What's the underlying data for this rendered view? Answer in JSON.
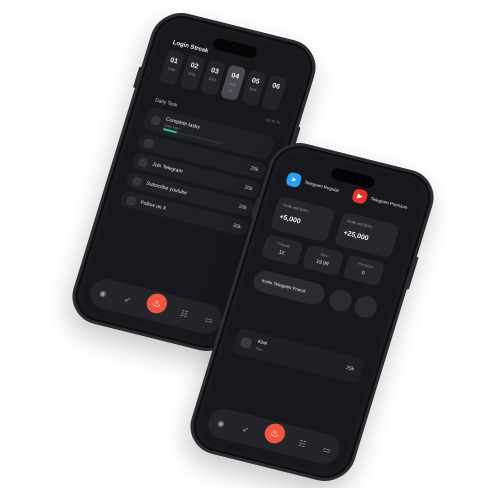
{
  "login_streak": {
    "title": "Login Streak",
    "days": [
      {
        "num": "01",
        "label": "100k",
        "check": ""
      },
      {
        "num": "02",
        "label": "200k",
        "check": ""
      },
      {
        "num": "03",
        "label": "300k",
        "check": ""
      },
      {
        "num": "04",
        "label": "400k",
        "check": "✓"
      },
      {
        "num": "05",
        "label": "500k",
        "check": ""
      },
      {
        "num": "06",
        "label": "",
        "check": ""
      }
    ],
    "more": "Up to 7k"
  },
  "daily": {
    "section_title": "Daily Task",
    "tasks": [
      {
        "title": "Complete tasks",
        "sub": "Daily login",
        "value": ""
      },
      {
        "title": "",
        "sub": "",
        "value": "25k"
      },
      {
        "title": "Join Telegram",
        "sub": "",
        "value": "20k"
      },
      {
        "title": "Subscribe youtube",
        "sub": "",
        "value": "20k"
      },
      {
        "title": "Follow on X",
        "sub": "",
        "value": "20k"
      }
    ]
  },
  "tabbar": {
    "icons": [
      "gift-icon",
      "rocket-icon",
      "flame-icon",
      "users-icon",
      "wallet-icon"
    ]
  },
  "invite_screen": {
    "telegram_regular": "Telegram Regular",
    "telegram_premium": "Telegram Premium",
    "invite_a_label": "Invite and Earn",
    "invite_a_value": "+5,000",
    "invite_b_label": "Invite and Earn",
    "invite_b_value": "+25,000",
    "stats": [
      {
        "label": "Friends",
        "value": "12"
      },
      {
        "label": "Earn",
        "value": "19.99"
      },
      {
        "label": "Premium",
        "value": "0"
      }
    ],
    "invite_button": "Invite Telegram Friend",
    "task_title": "Kiwi",
    "task_sub": "Max",
    "task_value": "25k"
  },
  "colors": {
    "accent": "#f0563f",
    "telegram": "#2a9ef0",
    "youtube": "#e0362c",
    "progress": "#2ec4a0"
  }
}
